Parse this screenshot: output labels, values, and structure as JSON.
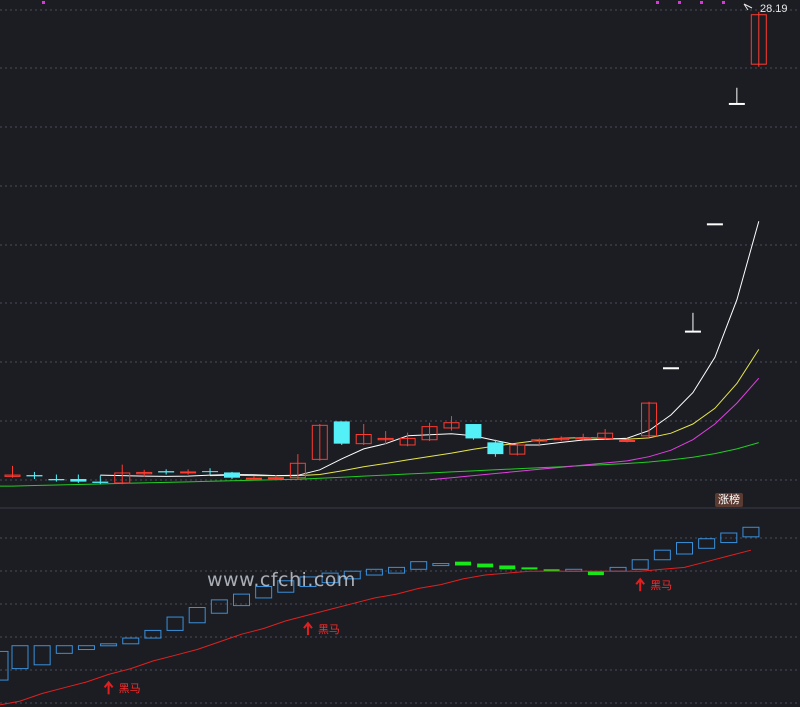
{
  "chart_data": {
    "type": "candlestick",
    "last_price_label": "28.19",
    "badge": "涨榜",
    "watermark": "www.cfchi.com",
    "colors": {
      "up": "#ff3b30",
      "down": "#54f0f7",
      "flat": "#ffffff",
      "ma5": "#ffffff",
      "ma10": "#e6e64c",
      "ma20": "#e040e0",
      "ma60": "#22cc22",
      "ind_up": "#3a8fd9",
      "ind_down": "#19e619",
      "ind_line": "#e02020",
      "grid": "#4a4d57"
    },
    "y_range": [
      9.8,
      28.6
    ],
    "candles": [
      [
        10.55,
        10.6,
        10.95,
        10.5
      ],
      [
        10.6,
        10.55,
        10.72,
        10.45
      ],
      [
        10.45,
        10.4,
        10.62,
        10.35
      ],
      [
        10.45,
        10.35,
        10.62,
        10.3
      ],
      [
        10.35,
        10.3,
        10.58,
        10.25
      ],
      [
        10.3,
        10.68,
        11.0,
        10.25
      ],
      [
        10.65,
        10.7,
        10.8,
        10.55
      ],
      [
        10.75,
        10.7,
        10.82,
        10.62
      ],
      [
        10.7,
        10.72,
        10.82,
        10.62
      ],
      [
        10.75,
        10.72,
        10.86,
        10.62
      ],
      [
        10.7,
        10.5,
        10.72,
        10.45
      ],
      [
        10.45,
        10.48,
        10.56,
        10.4
      ],
      [
        10.48,
        10.5,
        10.6,
        10.44
      ],
      [
        10.5,
        11.05,
        11.4,
        10.45
      ],
      [
        11.2,
        12.5,
        12.55,
        11.15
      ],
      [
        12.65,
        11.8,
        12.65,
        11.75
      ],
      [
        11.8,
        12.15,
        12.55,
        11.75
      ],
      [
        11.95,
        12.0,
        12.28,
        11.78
      ],
      [
        11.75,
        12.0,
        12.22,
        11.7
      ],
      [
        11.95,
        12.45,
        12.6,
        11.9
      ],
      [
        12.4,
        12.6,
        12.85,
        12.3
      ],
      [
        12.55,
        12.0,
        12.55,
        11.95
      ],
      [
        11.85,
        11.4,
        11.95,
        11.3
      ],
      [
        11.4,
        11.75,
        11.82,
        11.35
      ],
      [
        11.9,
        11.95,
        12.0,
        11.7
      ],
      [
        11.95,
        12.0,
        12.08,
        11.9
      ],
      [
        12.0,
        12.02,
        12.18,
        11.9
      ],
      [
        12.0,
        12.2,
        12.36,
        11.94
      ],
      [
        11.9,
        11.92,
        12.0,
        11.85
      ],
      [
        12.1,
        13.35,
        13.4,
        12.05
      ],
      [
        14.7,
        14.7,
        14.7,
        14.7
      ],
      [
        16.1,
        16.1,
        16.8,
        16.1
      ],
      [
        20.2,
        20.2,
        20.2,
        20.2
      ],
      [
        24.8,
        24.8,
        25.4,
        24.8
      ],
      [
        26.3,
        28.19,
        28.3,
        26.2
      ]
    ],
    "ma5": [
      null,
      null,
      null,
      null,
      10.6,
      10.58,
      10.56,
      10.55,
      10.56,
      10.6,
      10.62,
      10.61,
      10.58,
      10.59,
      10.8,
      11.22,
      11.6,
      11.8,
      12.1,
      12.14,
      12.18,
      12.1,
      11.92,
      11.75,
      11.75,
      11.85,
      11.94,
      11.97,
      12.01,
      12.3,
      12.9,
      13.75,
      15.1,
      17.3,
      20.3
    ],
    "ma10": [
      null,
      null,
      null,
      null,
      null,
      null,
      null,
      null,
      null,
      10.58,
      10.59,
      10.58,
      10.57,
      10.58,
      10.62,
      10.76,
      10.92,
      11.04,
      11.18,
      11.31,
      11.44,
      11.59,
      11.71,
      11.82,
      11.93,
      12.01,
      12.03,
      12.0,
      11.97,
      12.02,
      12.2,
      12.55,
      13.15,
      14.1,
      15.4
    ],
    "ma20": [
      null,
      null,
      null,
      null,
      null,
      null,
      null,
      null,
      null,
      null,
      null,
      null,
      null,
      null,
      null,
      null,
      null,
      null,
      null,
      10.42,
      10.5,
      10.58,
      10.66,
      10.74,
      10.82,
      10.9,
      10.98,
      11.06,
      11.14,
      11.3,
      11.55,
      11.95,
      12.55,
      13.35,
      14.3
    ],
    "ma60": [
      10.18,
      10.2,
      10.22,
      10.24,
      10.26,
      10.28,
      10.3,
      10.32,
      10.34,
      10.36,
      10.38,
      10.4,
      10.42,
      10.44,
      10.48,
      10.52,
      10.56,
      10.6,
      10.64,
      10.68,
      10.72,
      10.76,
      10.8,
      10.84,
      10.88,
      10.92,
      10.96,
      11.0,
      11.04,
      11.1,
      11.18,
      11.28,
      11.42,
      11.6,
      11.84
    ],
    "indicator": {
      "y_range": [
        0,
        100
      ],
      "boxes": [
        [
          18,
          30,
          "up"
        ],
        [
          20,
          30,
          "up"
        ],
        [
          26,
          30,
          "up"
        ],
        [
          28,
          30,
          "up"
        ],
        [
          30,
          31,
          "up"
        ],
        [
          31,
          34,
          "up"
        ],
        [
          34,
          38,
          "up"
        ],
        [
          38,
          45,
          "up"
        ],
        [
          42,
          50,
          "up"
        ],
        [
          47,
          54,
          "up"
        ],
        [
          51,
          57,
          "up"
        ],
        [
          55,
          61,
          "up"
        ],
        [
          58,
          64,
          "up"
        ],
        [
          61,
          66,
          "up"
        ],
        [
          63,
          68,
          "up"
        ],
        [
          65,
          69,
          "up"
        ],
        [
          67,
          70,
          "up"
        ],
        [
          68,
          71,
          "up"
        ],
        [
          70,
          74,
          "up"
        ],
        [
          72,
          73,
          "up"
        ],
        [
          72,
          74,
          "down"
        ],
        [
          71,
          73,
          "down"
        ],
        [
          70,
          72,
          "down"
        ],
        [
          70,
          71,
          "down"
        ],
        [
          69,
          70,
          "down"
        ],
        [
          69,
          70,
          "up"
        ],
        [
          67,
          69,
          "down"
        ],
        [
          69,
          71,
          "up"
        ],
        [
          70,
          75,
          "up"
        ],
        [
          75,
          80,
          "up"
        ],
        [
          78,
          84,
          "up"
        ],
        [
          81,
          86,
          "up"
        ],
        [
          84,
          89,
          "up"
        ],
        [
          87,
          92,
          "up"
        ]
      ],
      "line": [
        1,
        5,
        8,
        11,
        15,
        18,
        22,
        25,
        28,
        32,
        36,
        39,
        43,
        46,
        49,
        52,
        55,
        57,
        60,
        62,
        65,
        67,
        68,
        69,
        69,
        69,
        69,
        69,
        69,
        70,
        71,
        74,
        77,
        80
      ],
      "signals": [
        {
          "index": 4,
          "label": "黑马"
        },
        {
          "index": 13,
          "label": "黑马"
        },
        {
          "index": 28,
          "label": "黑马"
        }
      ]
    }
  }
}
